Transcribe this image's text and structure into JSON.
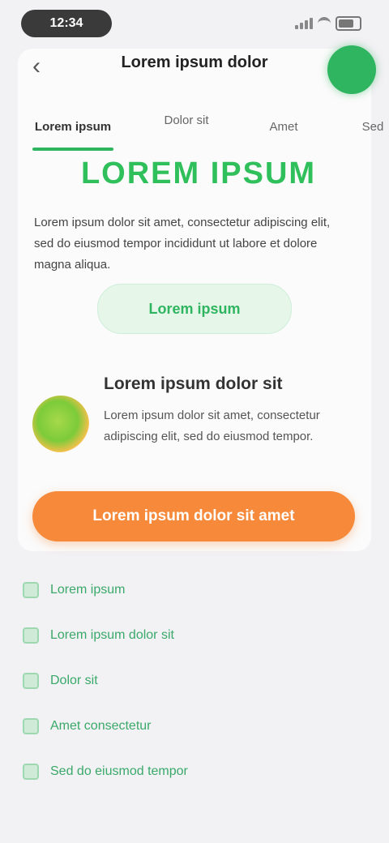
{
  "status": {
    "time": "12:34"
  },
  "header": {
    "title": "Lorem ipsum dolor"
  },
  "tabs": [
    {
      "label": "Lorem ipsum"
    },
    {
      "label": "Dolor sit"
    },
    {
      "label": "Amet"
    },
    {
      "label": "Sed"
    }
  ],
  "hero": {
    "headline": "LOREM IPSUM",
    "body": "Lorem ipsum dolor sit amet, consectetur adipiscing elit, sed do eiusmod tempor incididunt ut labore et dolore magna aliqua.",
    "pill_button": "Lorem ipsum"
  },
  "promo": {
    "title": "Lorem ipsum dolor sit",
    "text": "Lorem ipsum dolor sit amet, consectetur adipiscing elit, sed do eiusmod tempor.",
    "cta": "Lorem ipsum dolor sit amet"
  },
  "links": [
    {
      "label": "Lorem ipsum"
    },
    {
      "label": "Lorem ipsum dolor sit"
    },
    {
      "label": "Dolor sit"
    },
    {
      "label": "Amet consectetur"
    },
    {
      "label": "Sed do eiusmod tempor"
    }
  ],
  "colors": {
    "accent_green": "#2fb560",
    "accent_orange": "#f6893a",
    "background": "#f2f1f4"
  }
}
